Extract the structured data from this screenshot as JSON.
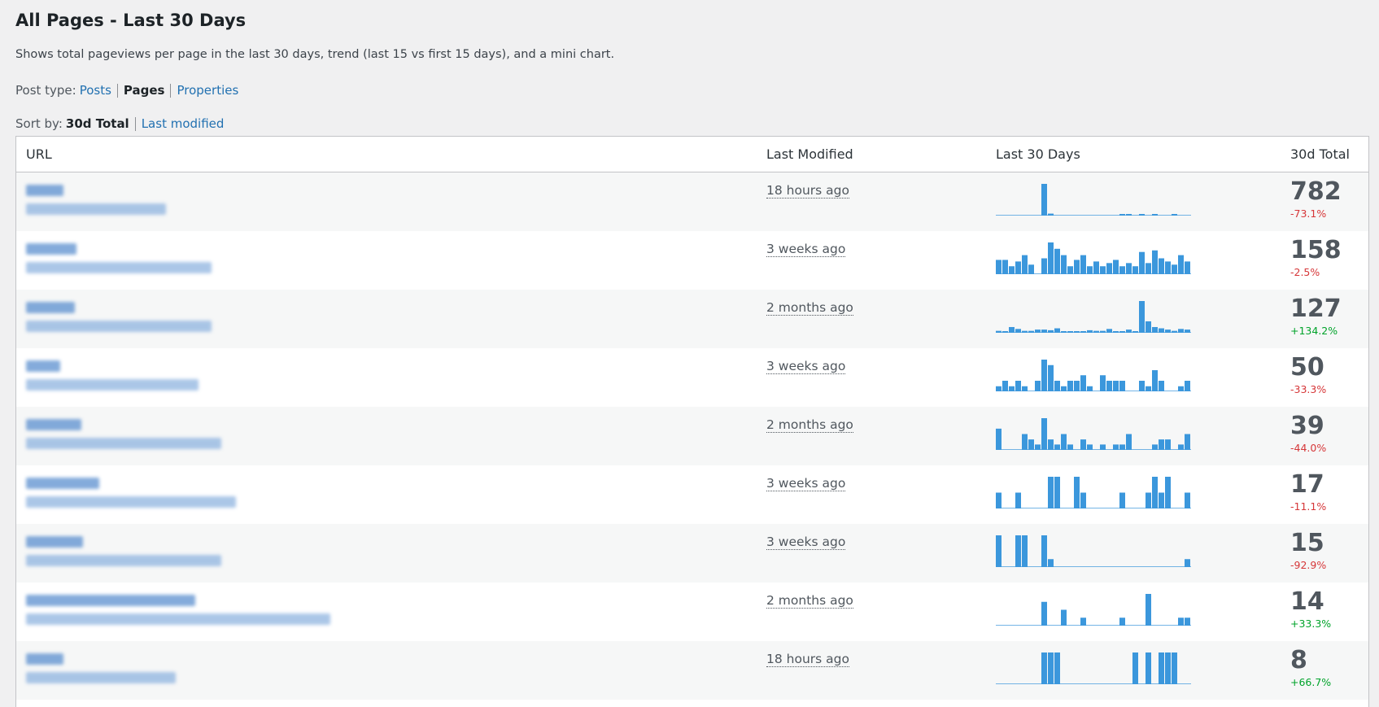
{
  "page": {
    "title": "All Pages - Last 30 Days",
    "description": "Shows total pageviews per page in the last 30 days, trend (last 15 vs first 15 days), and a mini chart."
  },
  "post_type": {
    "label": "Post type:",
    "options": [
      "Posts",
      "Pages",
      "Properties"
    ],
    "selected": "Pages"
  },
  "sort_by": {
    "label": "Sort by:",
    "options": [
      "30d Total",
      "Last modified"
    ],
    "selected": "30d Total"
  },
  "table": {
    "headers": {
      "url": "URL",
      "modified": "Last Modified",
      "chart": "Last 30 Days",
      "total": "30d Total"
    },
    "rows": [
      {
        "modified": "18 hours ago",
        "total": "782",
        "trend": "-73.1%",
        "trend_dir": "neg",
        "series": [
          0,
          0,
          0,
          0,
          0,
          0,
          0,
          96,
          6,
          0,
          0,
          0,
          0,
          0,
          0,
          0,
          0,
          0,
          0,
          1,
          1,
          0,
          1,
          0,
          1,
          0,
          0,
          1,
          0,
          0
        ]
      },
      {
        "modified": "3 weeks ago",
        "total": "158",
        "trend": "-2.5%",
        "trend_dir": "neg",
        "series": [
          45,
          45,
          25,
          40,
          60,
          30,
          0,
          50,
          100,
          80,
          60,
          25,
          45,
          60,
          25,
          40,
          25,
          35,
          45,
          25,
          35,
          25,
          70,
          35,
          75,
          50,
          40,
          30,
          60,
          40
        ]
      },
      {
        "modified": "2 months ago",
        "total": "127",
        "trend": "+134.2%",
        "trend_dir": "pos",
        "series": [
          6,
          5,
          18,
          12,
          6,
          6,
          10,
          10,
          8,
          14,
          4,
          4,
          4,
          4,
          8,
          6,
          6,
          12,
          4,
          4,
          10,
          4,
          100,
          36,
          18,
          14,
          10,
          6,
          12,
          10
        ]
      },
      {
        "modified": "3 weeks ago",
        "total": "50",
        "trend": "-33.3%",
        "trend_dir": "neg",
        "series": [
          12,
          25,
          12,
          25,
          12,
          0,
          25,
          75,
          62,
          25,
          12,
          25,
          25,
          38,
          12,
          0,
          38,
          25,
          25,
          25,
          0,
          0,
          25,
          12,
          50,
          25,
          0,
          0,
          12,
          25
        ]
      },
      {
        "modified": "2 months ago",
        "total": "39",
        "trend": "-44.0%",
        "trend_dir": "neg",
        "series": [
          67,
          0,
          0,
          0,
          50,
          33,
          17,
          100,
          33,
          17,
          50,
          17,
          0,
          33,
          17,
          0,
          17,
          0,
          17,
          17,
          50,
          0,
          0,
          0,
          17,
          33,
          33,
          0,
          17,
          50
        ]
      },
      {
        "modified": "3 weeks ago",
        "total": "17",
        "trend": "-11.1%",
        "trend_dir": "neg",
        "series": [
          50,
          0,
          0,
          50,
          0,
          0,
          0,
          0,
          100,
          100,
          0,
          0,
          100,
          50,
          0,
          0,
          0,
          0,
          0,
          50,
          0,
          0,
          0,
          50,
          100,
          50,
          100,
          0,
          0,
          50
        ]
      },
      {
        "modified": "3 weeks ago",
        "total": "15",
        "trend": "-92.9%",
        "trend_dir": "neg",
        "series": [
          100,
          0,
          0,
          100,
          100,
          0,
          0,
          100,
          25,
          0,
          0,
          0,
          0,
          0,
          0,
          0,
          0,
          0,
          0,
          0,
          0,
          0,
          0,
          0,
          0,
          0,
          0,
          0,
          0,
          25
        ]
      },
      {
        "modified": "2 months ago",
        "total": "14",
        "trend": "+33.3%",
        "trend_dir": "pos",
        "series": [
          0,
          0,
          0,
          0,
          0,
          0,
          0,
          75,
          0,
          0,
          50,
          0,
          0,
          25,
          0,
          0,
          0,
          0,
          0,
          25,
          0,
          0,
          0,
          100,
          0,
          0,
          0,
          0,
          25,
          25
        ]
      },
      {
        "modified": "18 hours ago",
        "total": "8",
        "trend": "+66.7%",
        "trend_dir": "pos",
        "series": [
          0,
          0,
          0,
          0,
          0,
          0,
          0,
          100,
          100,
          100,
          0,
          0,
          0,
          0,
          0,
          0,
          0,
          0,
          0,
          0,
          0,
          100,
          0,
          100,
          0,
          100,
          100,
          100,
          0,
          0
        ]
      }
    ]
  },
  "colors": {
    "bar": "#3b97dc",
    "baseline": "#3b97dc",
    "link": "#2271b1",
    "negative": "#d63638",
    "positive": "#00a32a"
  }
}
